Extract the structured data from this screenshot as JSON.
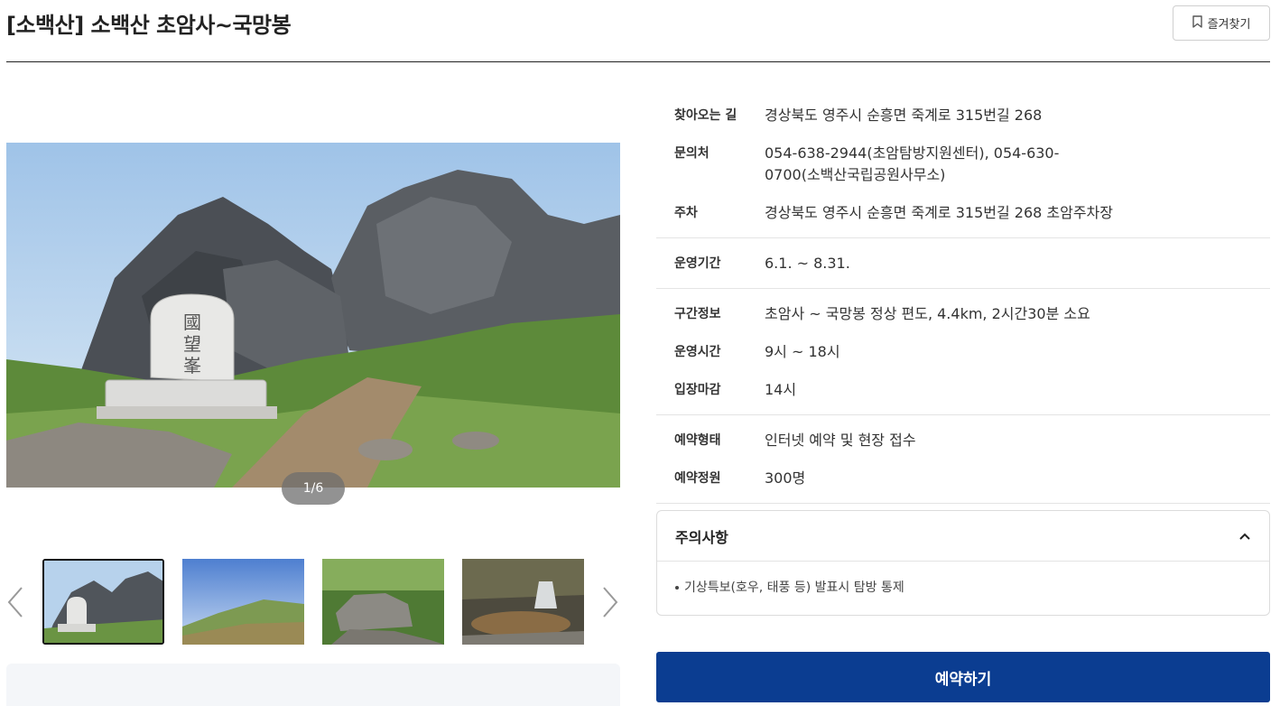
{
  "header": {
    "title": "[소백산] 소백산 초암사~국망봉",
    "favorite_label": "즐겨찾기"
  },
  "gallery": {
    "counter": "1/6",
    "thumbnails": [
      "thumb-peak-stone",
      "thumb-grass-slope",
      "thumb-forest-rocks",
      "thumb-waterfall"
    ]
  },
  "info": {
    "groups": [
      [
        {
          "label": "찾아오는 길",
          "value": "경상북도 영주시 순흥면 죽계로 315번길 268"
        },
        {
          "label": "문의처",
          "value": "054-638-2944(초암탐방지원센터), 054-630-0700(소백산국립공원사무소)"
        },
        {
          "label": "주차",
          "value": "경상북도 영주시 순흥면 죽계로 315번길 268 초암주차장"
        }
      ],
      [
        {
          "label": "운영기간",
          "value": "6.1. ~ 8.31."
        }
      ],
      [
        {
          "label": "구간정보",
          "value": "초암사 ~ 국망봉 정상 편도, 4.4km, 2시간30분 소요"
        },
        {
          "label": "운영시간",
          "value": "9시 ~ 18시"
        },
        {
          "label": "입장마감",
          "value": "14시"
        }
      ],
      [
        {
          "label": "예약형태",
          "value": "인터넷 예약 및 현장 접수"
        },
        {
          "label": "예약정원",
          "value": "300명"
        }
      ]
    ]
  },
  "notice": {
    "title": "주의사항",
    "item": "기상특보(호우, 태풍 등) 발표시 탐방 통제"
  },
  "reserve": {
    "label": "예약하기"
  },
  "colors": {
    "primary": "#0b3d91",
    "border": "#dcdcdc"
  }
}
